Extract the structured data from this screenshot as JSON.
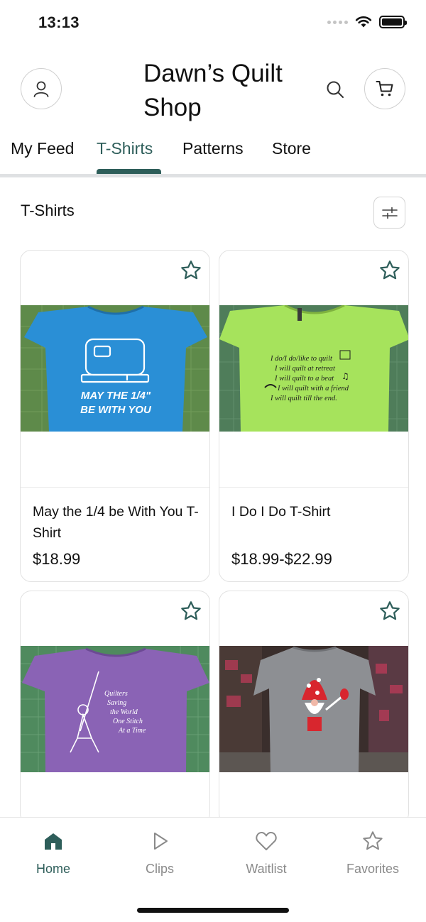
{
  "status_bar": {
    "time": "13:13"
  },
  "header": {
    "title": "Dawn’s Quilt Shop"
  },
  "tabs": [
    {
      "label": "My Feed",
      "active": false
    },
    {
      "label": "T-Shirts",
      "active": true
    },
    {
      "label": "Patterns",
      "active": false
    },
    {
      "label": "Store",
      "active": false
    }
  ],
  "section": {
    "title": "T-Shirts"
  },
  "products": [
    {
      "name": "May the 1/4 be With You T-Shirt",
      "price": "$18.99",
      "shirt_color": "#2a8fd6",
      "shirt_print": [
        "MAY THE 1/4\"",
        "BE WITH YOU"
      ]
    },
    {
      "name": "I Do I Do T-Shirt",
      "price": "$18.99-$22.99",
      "shirt_color": "#a6e35c",
      "shirt_print": [
        "I do/I do/like to quilt",
        "I will quilt at retreat",
        "I will quilt to a beat",
        "I will quilt with a friend",
        "I will quilt till the end."
      ]
    },
    {
      "name": "",
      "price": "",
      "shirt_color": "#8a63b5",
      "shirt_print": [
        "Quilters",
        "Saving",
        "the World",
        "One Stitch",
        "At a Time"
      ]
    },
    {
      "name": "",
      "price": "",
      "shirt_color": "#8d8f93",
      "shirt_print": []
    }
  ],
  "tabbar": [
    {
      "label": "Home",
      "active": true
    },
    {
      "label": "Clips",
      "active": false
    },
    {
      "label": "Waitlist",
      "active": false
    },
    {
      "label": "Favorites",
      "active": false
    }
  ],
  "colors": {
    "accent": "#2e5e5a",
    "inactive": "#8a8a8a",
    "border": "#e2e2e2"
  }
}
